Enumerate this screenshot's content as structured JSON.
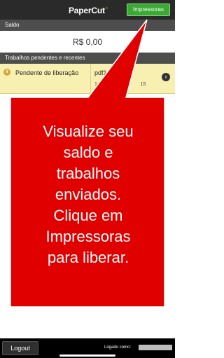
{
  "header": {
    "logo_text": "PaperCut",
    "printers_button": "Impressoras"
  },
  "balance_section": {
    "title": "Saldo",
    "value": "R$ 0,00"
  },
  "jobs_section": {
    "title": "Trabalhos pendentes e recentes",
    "jobs": [
      {
        "status_icon": "status-pending-icon",
        "status_glyph": "ll",
        "status": "Pendente de liberação",
        "file": "pdf1.pd",
        "time": "14:54",
        "time_extra": "15"
      }
    ]
  },
  "callout": {
    "text": "Visualize seu\nsaldo e\ntrabalhos\nenviados.\nClique em\nImpressoras\npara liberar.",
    "color": "#e00000"
  },
  "footer": {
    "logout_button": "Logout",
    "logged_as_label": "Logado como:"
  },
  "colors": {
    "header_bg": "#2a2a2a",
    "accent_green": "#3aaa35",
    "section_bg": "#4d4d4d",
    "pending_row_bg": "#f7f0b0"
  }
}
